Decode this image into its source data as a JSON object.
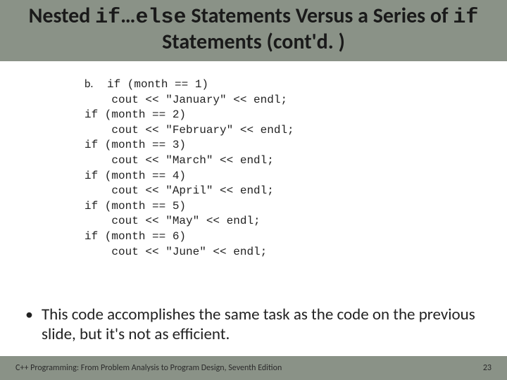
{
  "title": {
    "pre": "Nested ",
    "code1": "if",
    "mid1": "…",
    "code2": "else",
    "mid2": " Statements Versus a Series of ",
    "code3": "if",
    "post": " Statements (cont'd. )"
  },
  "code": {
    "label": "b.",
    "lines": [
      "if (month == 1)",
      "    cout << \"January\" << endl;",
      "if (month == 2)",
      "    cout << \"February\" << endl;",
      "if (month == 3)",
      "    cout << \"March\" << endl;",
      "if (month == 4)",
      "    cout << \"April\" << endl;",
      "if (month == 5)",
      "    cout << \"May\" << endl;",
      "if (month == 6)",
      "    cout << \"June\" << endl;"
    ]
  },
  "bullet": "This code accomplishes the same task as the code on the previous slide, but it's not as efficient.",
  "footer": {
    "left": "C++ Programming: From Problem Analysis to Program Design, Seventh Edition",
    "right": "23"
  }
}
